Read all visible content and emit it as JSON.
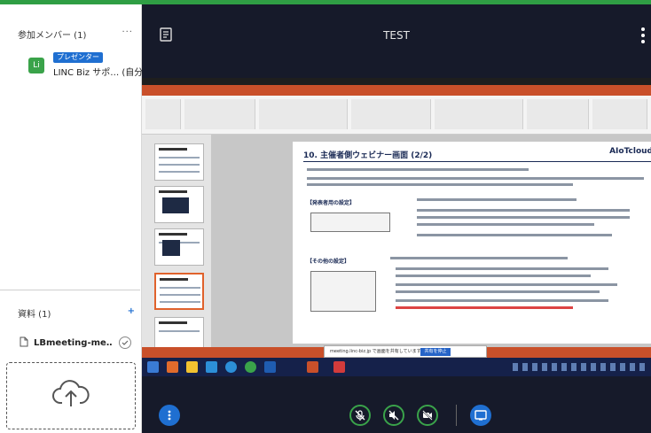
{
  "sidebar": {
    "members_title": "参加メンバー (1)",
    "more_symbol": "···",
    "member": {
      "avatar_initial": "Li",
      "role_badge": "プレゼンター",
      "name": "LINC Biz サポ… (自分)"
    },
    "documents_title": "資料 (1)",
    "documents_add": "+",
    "documents": [
      {
        "file_name": "LBmeeting-me…",
        "icon": "file-icon",
        "status_icon": "check-circle-icon"
      }
    ],
    "upload_icon": "cloud-upload-icon"
  },
  "meeting": {
    "title": "TEST",
    "document_icon": "document-icon",
    "menu_icon": "kebab-menu-icon"
  },
  "shared_screen": {
    "slide_title": "10. 主催者側ウェビナー画面 (2/2)",
    "brand": "AIoTcloud",
    "section_1": "【発表者用の設定】",
    "section_2": "【その他の設定】",
    "toast_text": "meeting.linc-biz.jp で画面を共有しています。",
    "toast_button": "共有を停止"
  },
  "controls": {
    "menu_icon": "menu-dots-icon",
    "mic_icon": "mic-off-icon",
    "speaker_icon": "speaker-off-icon",
    "camera_icon": "camera-off-icon",
    "screen_share_icon": "screen-share-icon"
  },
  "colors": {
    "accent_green": "#2f9e44",
    "primary_blue": "#1f6fd1",
    "main_background": "#161a2a"
  }
}
